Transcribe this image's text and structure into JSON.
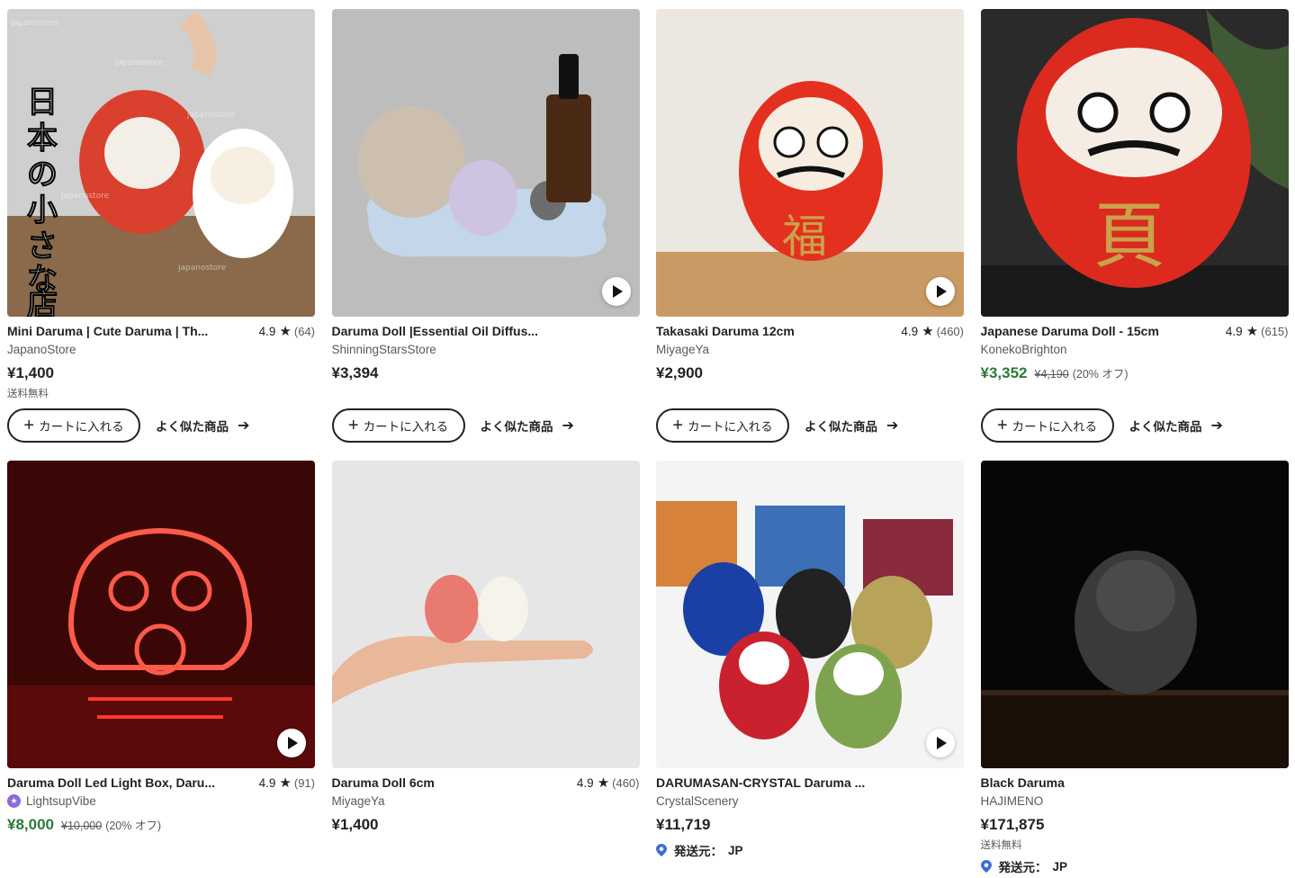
{
  "ui": {
    "add_to_cart": "カートに入れる",
    "similar_items": "よく似た商品",
    "ships_from_label": "発送元：",
    "free_shipping": "送料無料"
  },
  "colors": {
    "sale_price": "#2b7a3b",
    "star_seller": "#8c6bd6",
    "text": "#222222",
    "muted": "#595959"
  },
  "listings": [
    {
      "title": "Mini Daruma | Cute Daruma | Th...",
      "rating": "4.9",
      "reviews": "(64)",
      "shop": "JapanoStore",
      "price": "¥1,400",
      "free_shipping": "送料無料",
      "overlay_text": "日本の小さな店",
      "watermark": "japanostore"
    },
    {
      "title": "Daruma Doll |Essential Oil Diffus...",
      "shop": "ShinningStarsStore",
      "price": "¥3,394",
      "video": true
    },
    {
      "title": "Takasaki Daruma 12cm",
      "rating": "4.9",
      "reviews": "(460)",
      "shop": "MiyageYa",
      "price": "¥2,900",
      "video": true
    },
    {
      "title": "Japanese Daruma Doll - 15cm",
      "rating": "4.9",
      "reviews": "(615)",
      "shop": "KonekoBrighton",
      "price": "¥3,352",
      "original_price": "¥4,190",
      "discount": "(20% オフ)"
    },
    {
      "title": "Daruma Doll Led Light Box, Daru...",
      "rating": "4.9",
      "reviews": "(91)",
      "shop": "LightsupVibe",
      "star_seller": true,
      "price": "¥8,000",
      "original_price": "¥10,000",
      "discount": "(20% オフ)",
      "video": true
    },
    {
      "title": "Daruma Doll 6cm",
      "rating": "4.9",
      "reviews": "(460)",
      "shop": "MiyageYa",
      "price": "¥1,400"
    },
    {
      "title": "DARUMASAN-CRYSTAL Daruma ...",
      "shop": "CrystalScenery",
      "price": "¥11,719",
      "ships_from": "JP",
      "video": true
    },
    {
      "title": "Black Daruma",
      "shop": "HAJIMENO",
      "price": "¥171,875",
      "free_shipping": "送料無料",
      "ships_from": "JP"
    }
  ]
}
